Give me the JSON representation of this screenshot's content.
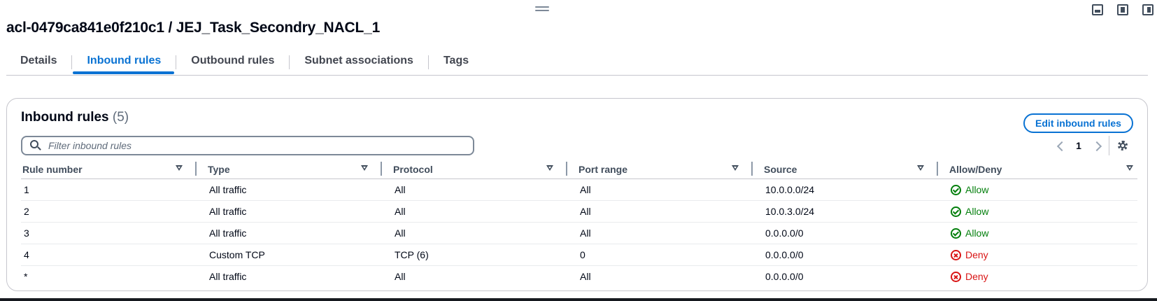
{
  "page": {
    "title": "acl-0479ca841e0f210c1 / JEJ_Task_Secondry_NACL_1"
  },
  "tabs": [
    {
      "label": "Details",
      "active": false
    },
    {
      "label": "Inbound rules",
      "active": true
    },
    {
      "label": "Outbound rules",
      "active": false
    },
    {
      "label": "Subnet associations",
      "active": false
    },
    {
      "label": "Tags",
      "active": false
    }
  ],
  "panel": {
    "title": "Inbound rules",
    "count": "(5)",
    "edit_button": "Edit inbound rules",
    "filter_placeholder": "Filter inbound rules",
    "current_page": "1"
  },
  "table": {
    "columns": [
      "Rule number",
      "Type",
      "Protocol",
      "Port range",
      "Source",
      "Allow/Deny"
    ],
    "rows": [
      {
        "rule": "1",
        "type": "All traffic",
        "protocol": "All",
        "port": "All",
        "source": "10.0.0.0/24",
        "action": "Allow"
      },
      {
        "rule": "2",
        "type": "All traffic",
        "protocol": "All",
        "port": "All",
        "source": "10.0.3.0/24",
        "action": "Allow"
      },
      {
        "rule": "3",
        "type": "All traffic",
        "protocol": "All",
        "port": "All",
        "source": "0.0.0.0/0",
        "action": "Allow"
      },
      {
        "rule": "4",
        "type": "Custom TCP",
        "protocol": "TCP (6)",
        "port": "0",
        "source": "0.0.0.0/0",
        "action": "Deny"
      },
      {
        "rule": "*",
        "type": "All traffic",
        "protocol": "All",
        "port": "All",
        "source": "0.0.0.0/0",
        "action": "Deny"
      }
    ]
  },
  "colors": {
    "accent": "#0972d3",
    "allow": "#037f0c",
    "deny": "#d91515",
    "text": "#000716"
  },
  "icons": {
    "allow": "check-circle-icon",
    "deny": "x-circle-icon",
    "search": "search-icon",
    "settings": "gear-icon",
    "sort": "sort-caret-icon"
  }
}
